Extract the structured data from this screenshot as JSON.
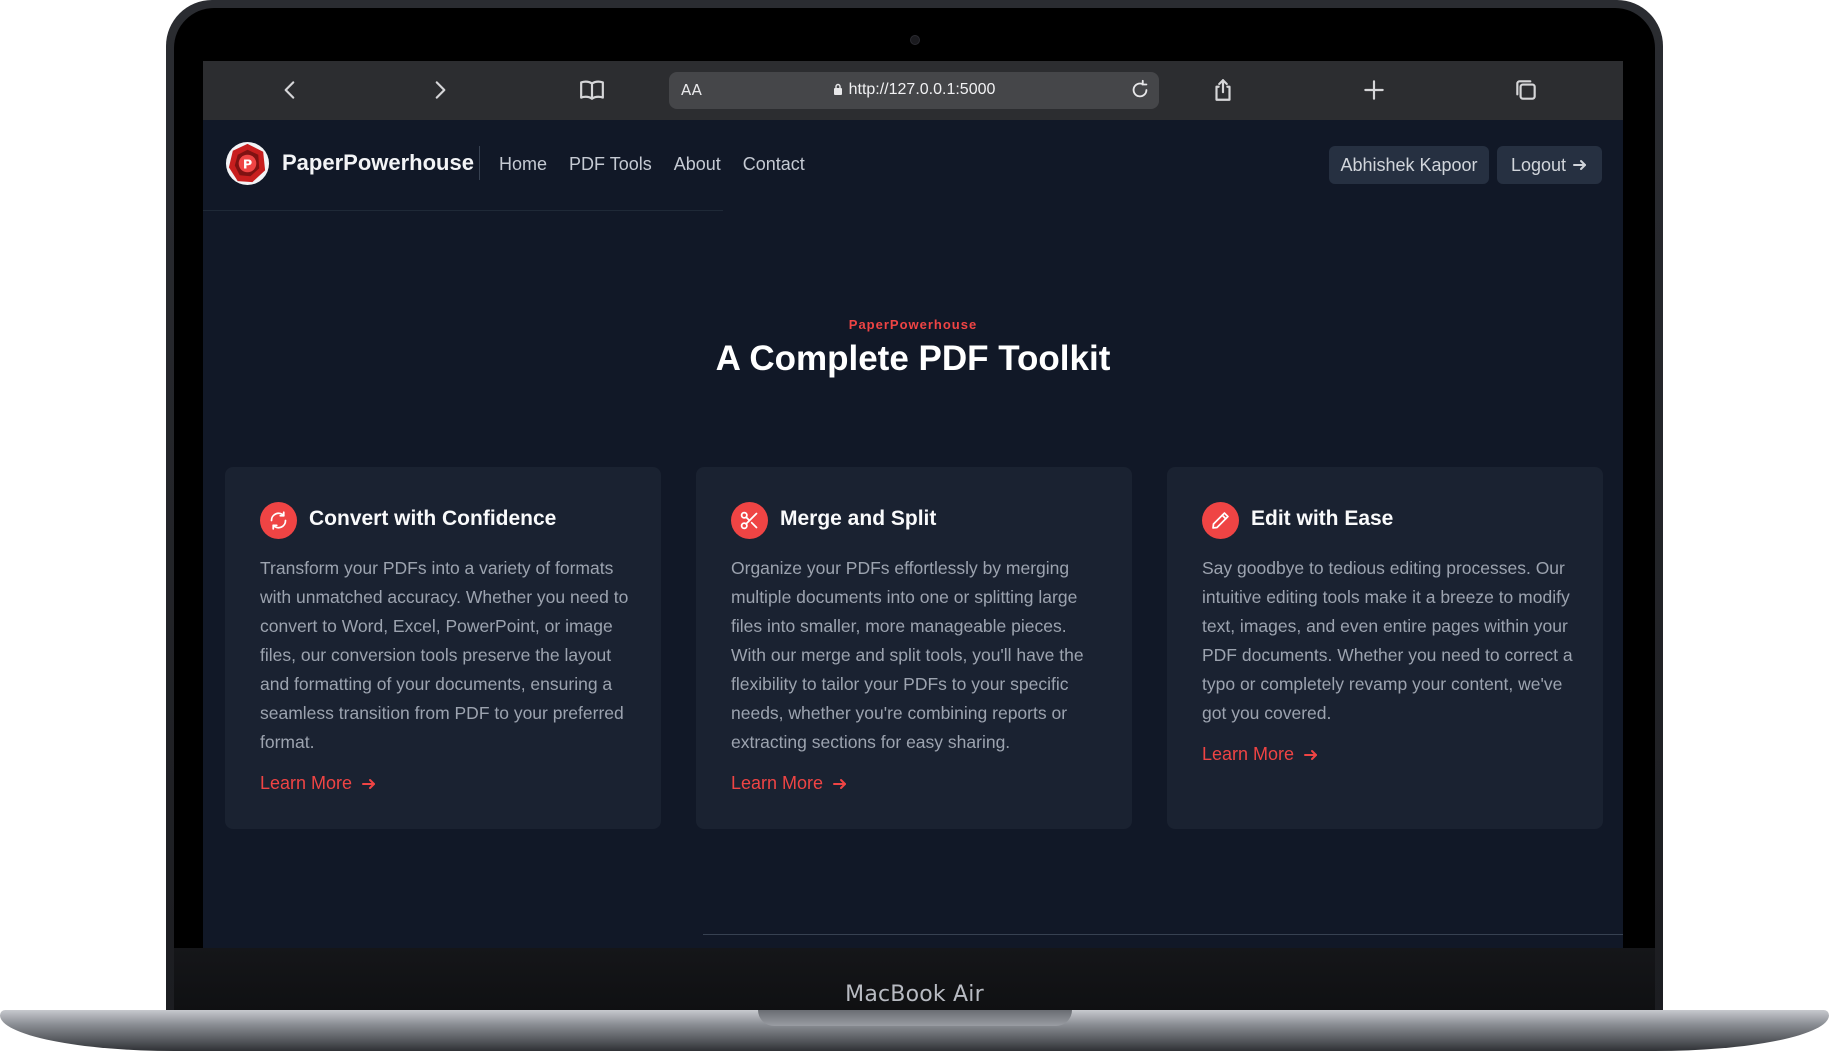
{
  "device": {
    "model_label": "MacBook Air"
  },
  "browser": {
    "text_size_label": "AA",
    "url": "http://127.0.0.1:5000",
    "icons": [
      "chevron-left-icon",
      "chevron-right-icon",
      "book-icon",
      "lock-icon",
      "reload-icon",
      "share-icon",
      "plus-icon",
      "tabs-icon"
    ]
  },
  "site": {
    "brand_name": "PaperPowerhouse",
    "nav": [
      "Home",
      "PDF Tools",
      "About",
      "Contact"
    ],
    "user_name": "Abhishek Kapoor",
    "logout_label": "Logout"
  },
  "hero": {
    "eyebrow": "PaperPowerhouse",
    "title": "A Complete PDF Toolkit"
  },
  "cards": [
    {
      "icon": "refresh-icon",
      "title": "Convert with Confidence",
      "body": "Transform your PDFs into a variety of formats with unmatched accuracy. Whether you need to convert to Word, Excel, PowerPoint, or image files, our conversion tools preserve the layout and formatting of your documents, ensuring a seamless transition from PDF to your preferred format.",
      "link": "Learn More"
    },
    {
      "icon": "scissors-icon",
      "title": "Merge and Split",
      "body": "Organize your PDFs effortlessly by merging multiple documents into one or splitting large files into smaller, more manageable pieces. With our merge and split tools, you'll have the flexibility to tailor your PDFs to your specific needs, whether you're combining reports or extracting sections for easy sharing.",
      "link": "Learn More"
    },
    {
      "icon": "pencil-icon",
      "title": "Edit with Ease",
      "body": "Say goodbye to tedious editing processes. Our intuitive editing tools make it a breeze to modify text, images, and even entire pages within your PDF documents. Whether you need to correct a typo or completely revamp your content, we've got you covered.",
      "link": "Learn More"
    }
  ],
  "colors": {
    "accent": "#ef4444",
    "page_bg": "#111827",
    "card_bg": "#1a2231"
  }
}
